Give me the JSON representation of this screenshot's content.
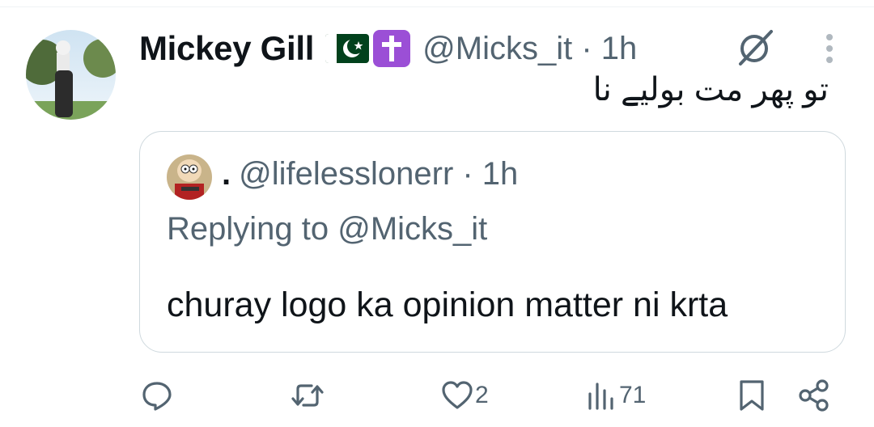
{
  "tweet": {
    "author_name": "Mickey Gill",
    "author_badges": [
      "pakistan-flag",
      "latin-cross-emoji"
    ],
    "handle": "@Micks_it",
    "time": "1h",
    "handle_time": "@Micks_it · 1h",
    "text": "تو پھر مت بولیے نا"
  },
  "quote": {
    "display_name": ".",
    "handle_time": "@lifelesslonerr · 1h",
    "replying_to": "Replying to @Micks_it",
    "text": "churay logo ka opinion matter ni krta"
  },
  "actions": {
    "reply_count": "",
    "retweet_count": "",
    "like_count": "2",
    "views_count": "71"
  },
  "colors": {
    "text_primary": "#0f1419",
    "text_secondary": "#536471",
    "border": "#cfd9de",
    "background": "#ffffff"
  },
  "icons": [
    "grok-icon",
    "more-vertical-icon",
    "reply-icon",
    "retweet-icon",
    "heart-icon",
    "views-icon",
    "bookmark-icon",
    "share-icon"
  ]
}
